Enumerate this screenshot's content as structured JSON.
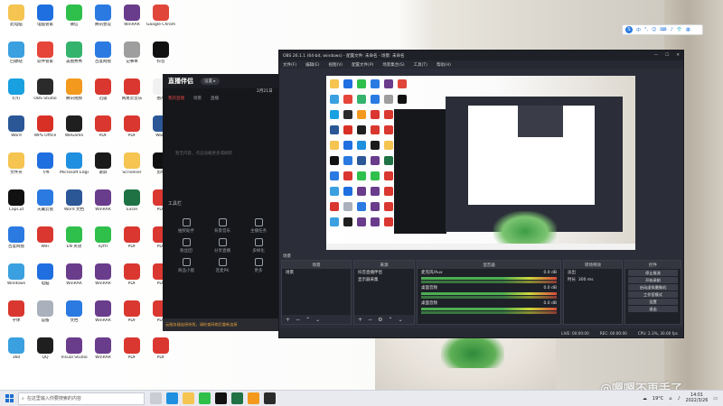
{
  "desktop": {
    "icons": [
      {
        "label": "此电脑",
        "color": "#f5c451"
      },
      {
        "label": "电脑管家",
        "color": "#1f6fe0"
      },
      {
        "label": "微信",
        "color": "#2fbf4b"
      },
      {
        "label": "腾讯会议",
        "color": "#2a7ae2"
      },
      {
        "label": "WinRAR",
        "color": "#6a3c8c"
      },
      {
        "label": "Google Chrome",
        "color": "#e0463a"
      },
      {
        "label": "回收站",
        "color": "#3aa0e0"
      },
      {
        "label": "软件管家",
        "color": "#e6453a"
      },
      {
        "label": "美图秀秀",
        "color": "#34b36c"
      },
      {
        "label": "百度网盘",
        "color": "#2a7ae2"
      },
      {
        "label": "记事本",
        "color": "#9e9e9e"
      },
      {
        "label": "抖音",
        "color": "#111111"
      },
      {
        "label": "钉钉",
        "color": "#19a0e0"
      },
      {
        "label": "OBS Studio",
        "color": "#2b2b2b"
      },
      {
        "label": "腾讯视频",
        "color": "#f39a1e"
      },
      {
        "label": "迅雷",
        "color": "#d9372f"
      },
      {
        "label": "网易云音乐",
        "color": "#d9372f"
      },
      {
        "label": "图片",
        "color": "#f1f1f1"
      },
      {
        "label": "Word",
        "color": "#2b5797"
      },
      {
        "label": "WPS Office",
        "color": "#d93025"
      },
      {
        "label": "WeGame",
        "color": "#1f1f1f"
      },
      {
        "label": "PDF",
        "color": "#d9372f"
      },
      {
        "label": "PDF",
        "color": "#d9372f"
      },
      {
        "label": "Word",
        "color": "#2b5797"
      },
      {
        "label": "文件夹",
        "color": "#f5c451"
      },
      {
        "label": "飞书",
        "color": "#1f6fe0"
      },
      {
        "label": "Microsoft Edge",
        "color": "#1f8fe0"
      },
      {
        "label": "录屏",
        "color": "#1a1a1a"
      },
      {
        "label": "Scrivener",
        "color": "#f5c451"
      },
      {
        "label": "剪映",
        "color": "#111111"
      },
      {
        "label": "CapCut",
        "color": "#111111"
      },
      {
        "label": "天翼云盘",
        "color": "#2a7ae2"
      },
      {
        "label": "Word 文档",
        "color": "#2b5797"
      },
      {
        "label": "WinRAR",
        "color": "#6a3c8c"
      },
      {
        "label": "Excel",
        "color": "#1f7244"
      },
      {
        "label": "PDF",
        "color": "#d9372f"
      },
      {
        "label": "百度网盘",
        "color": "#2a7ae2"
      },
      {
        "label": "WiFi",
        "color": "#d9372f"
      },
      {
        "label": "EN 英语",
        "color": "#2fbf4b"
      },
      {
        "label": "iQIYI",
        "color": "#2fbf4b"
      },
      {
        "label": "PDF",
        "color": "#d9372f"
      },
      {
        "label": "PDF",
        "color": "#d9372f"
      },
      {
        "label": "Windows",
        "color": "#3aa0e0"
      },
      {
        "label": "电脑",
        "color": "#1f6fe0"
      },
      {
        "label": "WinRAR",
        "color": "#6a3c8c"
      },
      {
        "label": "WinRAR",
        "color": "#6a3c8c"
      },
      {
        "label": "PDF",
        "color": "#d9372f"
      },
      {
        "label": "PDF",
        "color": "#d9372f"
      },
      {
        "label": "字体",
        "color": "#d9372f"
      },
      {
        "label": "设备",
        "color": "#aab1bc"
      },
      {
        "label": "文档",
        "color": "#2a7ae2"
      },
      {
        "label": "WinRAR",
        "color": "#6a3c8c"
      },
      {
        "label": "PDF",
        "color": "#d9372f"
      },
      {
        "label": "PDF",
        "color": "#d9372f"
      },
      {
        "label": "360",
        "color": "#3aa0e0"
      },
      {
        "label": "QQ",
        "color": "#1f1f1f"
      },
      {
        "label": "Visual Studio",
        "color": "#6a3c8c"
      },
      {
        "label": "WinRAR",
        "color": "#6a3c8c"
      },
      {
        "label": "PDF",
        "color": "#d9372f"
      },
      {
        "label": "PDF",
        "color": "#d9372f"
      }
    ],
    "watermark": "@嗯嗯不再手了"
  },
  "ime_bar": {
    "logo": "S",
    "items": [
      "中",
      "°,",
      "☺",
      "⌨",
      "♪",
      "👕",
      "▦"
    ]
  },
  "live_window": {
    "logo": "直播伴侣",
    "badge": "设置 ▸",
    "tabs": [
      "我的直播",
      "场景",
      "直播"
    ],
    "date_label": "2月21日",
    "empty_text": "暂无内容，点击加载更多或刷新",
    "tools_title": "工具栏",
    "tools": [
      "抽奖助手",
      "背景音乐",
      "主播任务",
      "粉丝团",
      "分享直播",
      "多样化",
      "商品小窗",
      "连麦PK",
      "更多"
    ],
    "bottom_notice": "云服务器连接失败，请检查网络后重新连接"
  },
  "obs": {
    "title": "OBS 26.1.1 (64-bit, windows) - 配置文件: 未命名 - 场景: 未命名",
    "menu": [
      "文件(F)",
      "编辑(E)",
      "视图(V)",
      "配置文件(P)",
      "场景集合(S)",
      "工具(T)",
      "帮助(H)"
    ],
    "docks": {
      "scenes_title": "场景",
      "scenes": [
        "场景"
      ],
      "sources_title": "来源",
      "sources": [
        "抖音直播伴侣",
        "显示器采集"
      ],
      "mixer_title": "混音器",
      "mixer_items": [
        {
          "name": "麦克风/Aux",
          "db": "0.0 dB"
        },
        {
          "name": "桌面音频",
          "db": "0.0 dB"
        },
        {
          "name": "桌面音频",
          "db": "0.0 dB"
        }
      ],
      "transitions_title": "转场特效",
      "transition_type": "淡出",
      "duration_label": "时长",
      "duration_value": "300 ms",
      "controls_title": "控件",
      "controls": [
        "停止推流",
        "开始录制",
        "启动虚拟摄像机",
        "工作室模式",
        "设置",
        "退出"
      ]
    },
    "status": {
      "live": "LIVE: 00:00:00",
      "rec": "REC: 00:00:00",
      "cpu": "CPU: 2.3%, 30.00 fps"
    }
  },
  "taskbar": {
    "search_placeholder": "在这里输入你要搜索的内容",
    "weather": "19°C",
    "time": "14:01",
    "date": "2022/3/26"
  }
}
